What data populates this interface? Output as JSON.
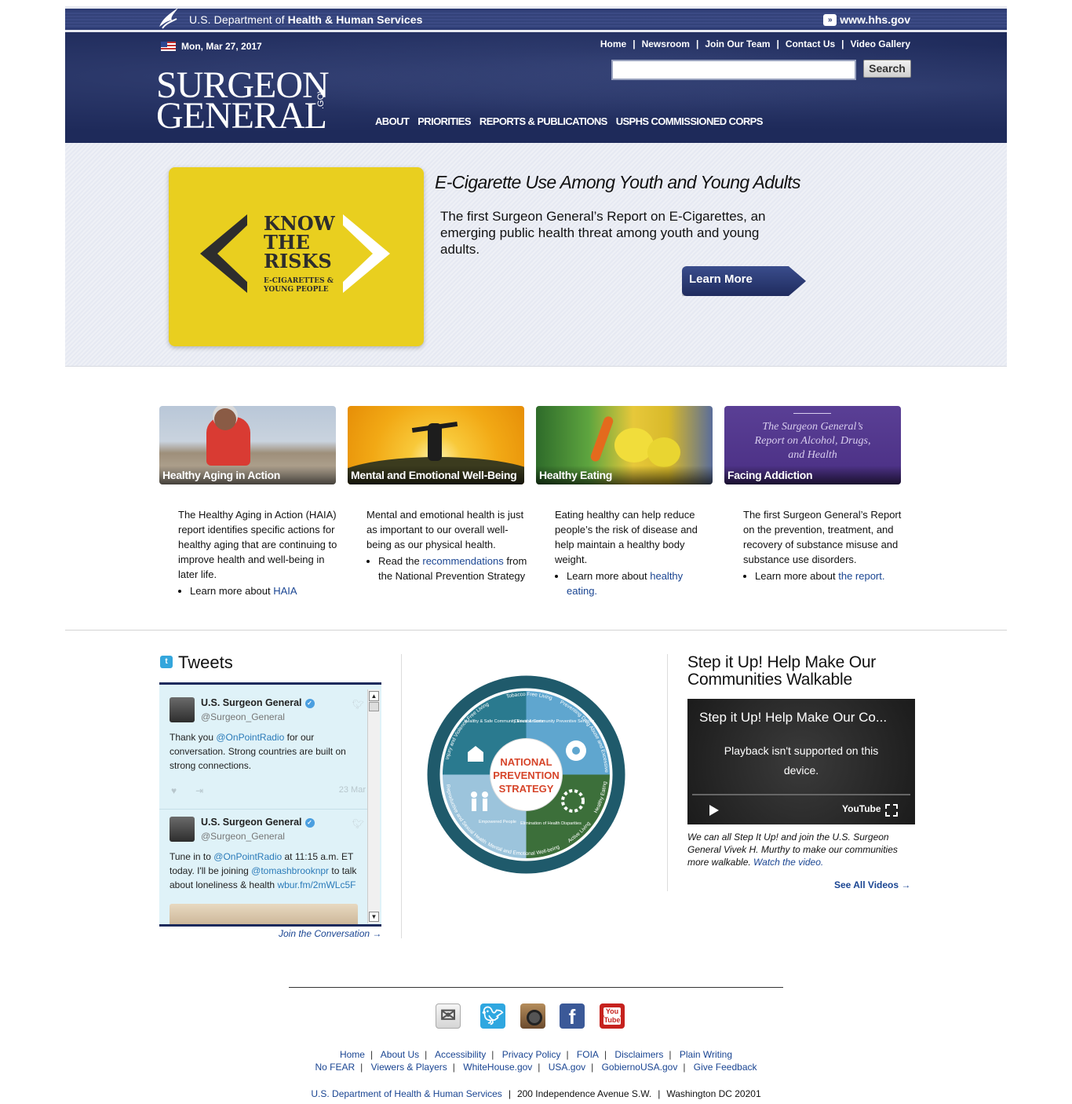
{
  "hhs": {
    "title_pre": "U.S. Department of ",
    "title_bold": "Health & Human Services",
    "site_link": "www.hhs.gov"
  },
  "header": {
    "date": "Mon, Mar 27, 2017",
    "utility_nav": [
      "Home",
      "Newsroom",
      "Join Our Team",
      "Contact Us",
      "Video Gallery"
    ],
    "search": {
      "placeholder": "",
      "button": "Search"
    },
    "logo_line1": "SURGEON",
    "logo_line2": "GENERAL",
    "logo_suffix": ".GOV",
    "main_nav": [
      "ABOUT",
      "PRIORITIES",
      "REPORTS & PUBLICATIONS",
      "USPHS COMMISSIONED CORPS"
    ]
  },
  "hero": {
    "card_title": "KNOW THE RISKS",
    "card_subtitle": "E-CIGARETTES & YOUNG PEOPLE",
    "title": "E-Cigarette Use Among Youth and Young Adults",
    "text": "The first Surgeon General’s Report on E-Cigarettes, an emerging public health threat among youth and young adults.",
    "button": "Learn More",
    "card_color": "#e9cf1f"
  },
  "features": [
    {
      "caption": "Healthy Aging in Action",
      "text": "The Healthy Aging in Action (HAIA) report identifies specific actions for healthy aging that are continuing to improve health and well-being in later life.",
      "bullet_pre": "Learn more about ",
      "bullet_link": "HAIA",
      "bullet_post": ""
    },
    {
      "caption": "Mental and Emotional Well-Being",
      "text": "Mental and emotional health is just as important to our overall well-being as our physical health.",
      "bullet_pre": "Read the ",
      "bullet_link": "recommendations",
      "bullet_post": " from the National Prevention Strategy"
    },
    {
      "caption": "Healthy Eating",
      "text": "Eating healthy can help reduce people’s the risk of disease and help maintain a healthy body weight.",
      "bullet_pre": "Learn more about ",
      "bullet_link": "healthy eating.",
      "bullet_post": ""
    },
    {
      "caption": "Facing Addiction",
      "image_text": "The Surgeon General’s Report on Alcohol, Drugs, and Health",
      "text": "The first Surgeon General’s Report on the prevention, treatment, and recovery of substance misuse and substance use disorders.",
      "bullet_pre": "Learn more about ",
      "bullet_link": "the report.",
      "bullet_post": ""
    }
  ],
  "tweets": {
    "heading": "Tweets",
    "items": [
      {
        "name": "U.S. Surgeon General",
        "handle": "@Surgeon_General",
        "pre": "Thank you ",
        "mention": "@OnPointRadio",
        "post": " for our conversation. Strong countries are built on strong connections.",
        "time": "23 Mar"
      },
      {
        "name": "U.S. Surgeon General",
        "handle": "@Surgeon_General",
        "pre": "Tune in to ",
        "mention": "@OnPointRadio",
        "mid": " at 11:15 a.m. ET today. I'll be joining ",
        "mention2": "@tomashbrooknpr",
        "post": " to talk about loneliness & health ",
        "link": "wbur.fm/2mWLc5F"
      }
    ],
    "join": "Join the Conversation →"
  },
  "wheel": {
    "center": [
      "NATIONAL",
      "PREVENTION",
      "STRATEGY"
    ],
    "quadrants": [
      "Healthy & Safe Community Environments",
      "Clinical & Community Preventive Services",
      "Empowered People",
      "Elimination of Health Disparities"
    ],
    "ring": [
      "Tobacco Free Living",
      "Preventing Drug Abuse and Excessive Alcohol Use",
      "Healthy Eating",
      "Active Living",
      "Mental and Emotional Well-being",
      "Reproductive and Sexual Health",
      "Injury and Violence Free Living"
    ]
  },
  "video": {
    "heading": "Step it Up! Help Make Our Communities Walkable",
    "title": "Step it Up! Help Make Our Co...",
    "message": "Playback isn't supported on this device.",
    "yt_label": "YouTube",
    "caption": "We can all Step It Up! and join the U.S. Surgeon General Vivek H. Murthy to make our communities more walkable. ",
    "caption_link": "Watch the video.",
    "see_all": "See All Videos →"
  },
  "footer": {
    "row1": [
      "Home",
      "About Us",
      "Accessibility",
      "Privacy Policy",
      "FOIA",
      "Disclaimers",
      "Plain Writing"
    ],
    "row2": [
      "No FEAR",
      "Viewers & Players",
      "WhiteHouse.gov",
      "USA.gov",
      "GobiernoUSA.gov",
      "Give Feedback"
    ],
    "address_link": "U.S. Department of Health & Human Services",
    "street": "200 Independence Avenue S.W.",
    "city": "Washington DC 20201",
    "social": [
      "email-icon",
      "twitter-icon",
      "instagram-icon",
      "facebook-icon",
      "youtube-icon"
    ]
  }
}
